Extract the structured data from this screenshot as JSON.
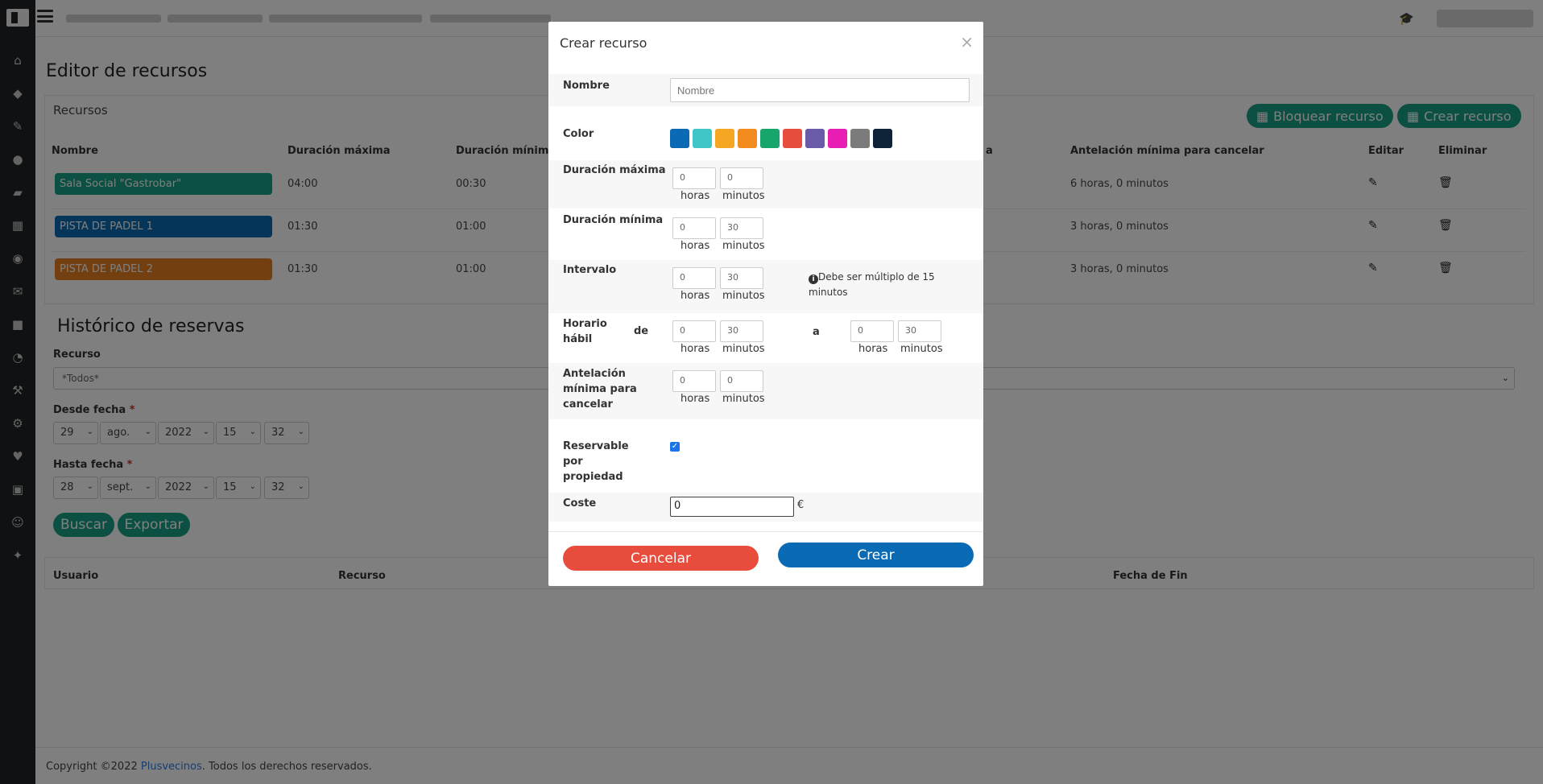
{
  "background": {
    "page_title": "Editor de recursos",
    "panel_title": "Recursos",
    "btn_block": "Bloquear recurso",
    "btn_create": "Crear recurso",
    "headers": {
      "nombre": "Nombre",
      "dur_max": "Duración máxima",
      "dur_min": "Duración mínima",
      "col_partial": "a",
      "antelacion": "Antelación mínima para cancelar",
      "editar": "Editar",
      "eliminar": "Eliminar"
    },
    "rows": [
      {
        "name": "Sala Social \"Gastrobar\"",
        "color": "#16a085",
        "dur_max": "04:00",
        "dur_min": "00:30",
        "antelacion": "6 horas, 0 minutos"
      },
      {
        "name": "PISTA DE PADEL 1",
        "color": "#0a6ab3",
        "dur_max": "01:30",
        "dur_min": "01:00",
        "antelacion": "3 horas, 0 minutos"
      },
      {
        "name": "PISTA DE PADEL 2",
        "color": "#e67e22",
        "dur_max": "01:30",
        "dur_min": "01:00",
        "antelacion": "3 horas, 0 minutos"
      }
    ],
    "hist_title": "Histórico de reservas",
    "recurso_label": "Recurso",
    "recurso_value": "*Todos*",
    "desde_label": "Desde fecha",
    "hasta_label": "Hasta fecha",
    "req": "*",
    "desde": {
      "day": "29",
      "month": "ago.",
      "year": "2022",
      "hour": "15",
      "min": "32"
    },
    "hasta": {
      "day": "28",
      "month": "sept.",
      "year": "2022",
      "hour": "15",
      "min": "32"
    },
    "btn_buscar": "Buscar",
    "btn_exportar": "Exportar",
    "hist_headers": {
      "usuario": "Usuario",
      "recurso": "Recurso",
      "fin": "Fecha de Fin"
    },
    "footer": {
      "prefix": "Copyright ©2022 ",
      "brand": "Plusvecinos",
      "suffix": ". Todos los derechos reservados."
    }
  },
  "modal": {
    "title": "Crear recurso",
    "close": "×",
    "nombre_label": "Nombre",
    "nombre_placeholder": "Nombre",
    "color_label": "Color",
    "colors": [
      "#0a6ab3",
      "#3ec6c8",
      "#f5a623",
      "#f28c1e",
      "#16a56b",
      "#e74c3c",
      "#6b5aa8",
      "#e91eb5",
      "#7b7b7b",
      "#0e2338"
    ],
    "dur_max_label": "Duración máxima",
    "dur_max": {
      "h": "0",
      "m": "0"
    },
    "dur_min_label": "Duración mínima",
    "dur_min": {
      "h": "0",
      "m": "30"
    },
    "intervalo_label": "Intervalo",
    "intervalo": {
      "h": "0",
      "m": "30"
    },
    "intervalo_note": "Debe ser múltiplo de 15 minutos",
    "horario_label": "Horario hábil",
    "de": "de",
    "a": "a",
    "horario_from": {
      "h": "0",
      "m": "30"
    },
    "horario_to": {
      "h": "0",
      "m": "30"
    },
    "antelacion_label": "Antelación mínima para cancelar",
    "antelacion": {
      "h": "0",
      "m": "0"
    },
    "horas": "horas",
    "minutos": "minutos",
    "reservable_label": "Reservable por propiedad",
    "reservable_checked": true,
    "coste_label": "Coste",
    "coste_value": "0",
    "currency": "€",
    "cancel": "Cancelar",
    "create": "Crear"
  }
}
